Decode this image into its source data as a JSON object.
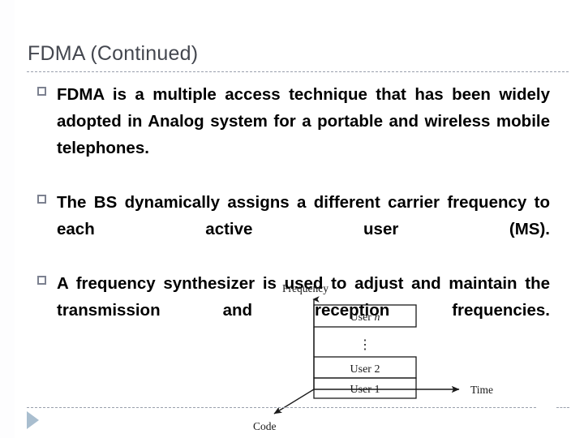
{
  "slide": {
    "title": "FDMA (Continued)",
    "bullets": [
      "FDMA is a multiple access technique that has been widely adopted in Analog system for a portable and wireless mobile telephones.",
      "The BS dynamically assigns a different carrier frequency to each active user (MS).",
      "A frequency synthesizer is used to adjust and maintain the transmission and reception frequencies."
    ],
    "bullet_glyph": "hollow-square",
    "colors": {
      "title": "#44474f",
      "body_text": "#000000",
      "bullet_square": "#7c8190",
      "rule": "#9aa0ad",
      "play_triangle": "#a9becf",
      "diagram_stroke": "#1a1a1a"
    }
  },
  "diagram": {
    "axes": {
      "vertical": "Frequency",
      "horizontal": "Time",
      "depth": "Code"
    },
    "channels": [
      {
        "label_prefix": "User ",
        "label_value": "n",
        "italic_value": true
      },
      {
        "label_prefix": "",
        "label_value": "⋮",
        "italic_value": false
      },
      {
        "label_prefix": "User ",
        "label_value": "2",
        "italic_value": false
      },
      {
        "label_prefix": "User ",
        "label_value": "1",
        "italic_value": false
      }
    ]
  }
}
